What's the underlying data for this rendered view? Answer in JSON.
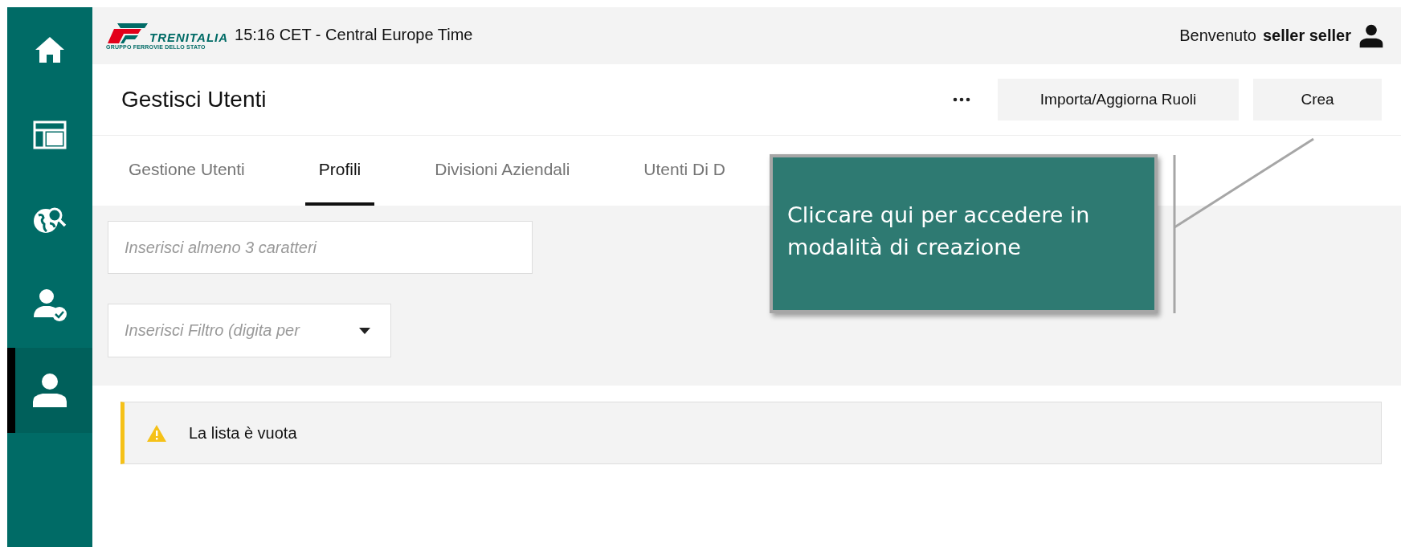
{
  "header": {
    "logo": {
      "wordmark": "TRENITALIA",
      "tagline": "GRUPPO FERROVIE DELLO STATO"
    },
    "time": "15:16 CET - Central Europe Time",
    "welcome": "Benvenuto",
    "user": "seller seller"
  },
  "sidebar": {
    "items": [
      {
        "kind": "home",
        "selected": false
      },
      {
        "kind": "layout",
        "selected": false
      },
      {
        "kind": "globe-search",
        "selected": false
      },
      {
        "kind": "user-check",
        "selected": false
      },
      {
        "kind": "user",
        "selected": true
      }
    ]
  },
  "page": {
    "title": "Gestisci Utenti",
    "buttons": [
      "Importa/Aggiorna Ruoli",
      "Crea"
    ]
  },
  "tabs": [
    {
      "label": "Gestione Utenti",
      "selected": false
    },
    {
      "label": "Profili",
      "selected": true
    },
    {
      "label": "Divisioni Aziendali",
      "selected": false
    },
    {
      "label": "Utenti Di D",
      "selected": false
    }
  ],
  "search": {
    "placeholder": "Inserisci almeno 3 caratteri"
  },
  "filter": {
    "placeholder": "Inserisci Filtro (digita per"
  },
  "alert": {
    "message": "La lista è vuota"
  },
  "callout": {
    "text": "Cliccare qui per accedere in modalità di creazione"
  }
}
